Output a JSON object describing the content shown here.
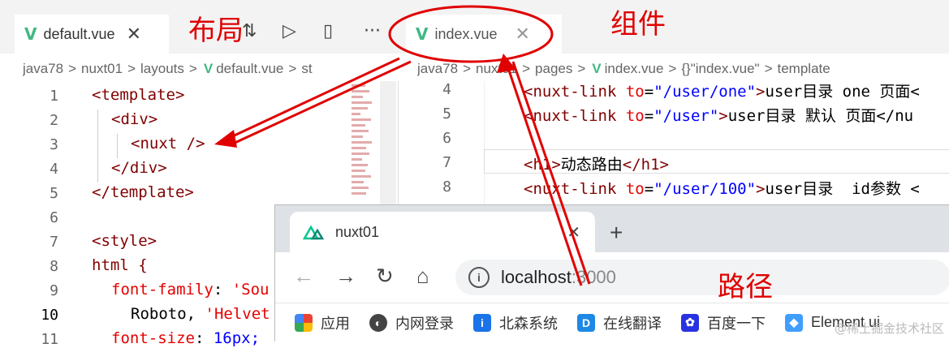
{
  "editor": {
    "tab_left": {
      "name": "default.vue",
      "close": "✕"
    },
    "tab_right": {
      "name": "index.vue",
      "close": "✕"
    },
    "toolbar_icons": [
      "compare-icon",
      "run-icon",
      "split-icon",
      "more-icon"
    ],
    "breadcrumb_left": [
      "java78",
      "nuxt01",
      "layouts",
      "default.vue",
      "st"
    ],
    "breadcrumb_right": [
      "java78",
      "nuxt01",
      "pages",
      "index.vue",
      "{}\"index.vue\"",
      "template"
    ],
    "left_lines": [
      {
        "n": "1",
        "parts": [
          [
            "tag",
            "<template>"
          ]
        ],
        "indent": 0
      },
      {
        "n": "2",
        "parts": [
          [
            "tag",
            "<div>"
          ]
        ],
        "indent": 1
      },
      {
        "n": "3",
        "parts": [
          [
            "tag",
            "<nuxt />"
          ]
        ],
        "indent": 2
      },
      {
        "n": "4",
        "parts": [
          [
            "tag",
            "</div>"
          ]
        ],
        "indent": 1
      },
      {
        "n": "5",
        "parts": [
          [
            "tag",
            "</template>"
          ]
        ],
        "indent": 0
      },
      {
        "n": "6",
        "parts": [],
        "indent": 0
      },
      {
        "n": "7",
        "parts": [
          [
            "tag",
            "<style>"
          ]
        ],
        "indent": 0
      },
      {
        "n": "8",
        "parts": [
          [
            "sel",
            "html {"
          ]
        ],
        "indent": 0
      },
      {
        "n": "9",
        "parts": [
          [
            "prop",
            "font-family"
          ],
          [
            "txt",
            ": "
          ],
          [
            "attr",
            "'Sou"
          ]
        ],
        "indent": 1
      },
      {
        "n": "10",
        "parts": [
          [
            "txt",
            "Roboto, "
          ],
          [
            "attr",
            "'Helvet"
          ]
        ],
        "indent": 2
      },
      {
        "n": "11",
        "parts": [
          [
            "prop",
            "font-size"
          ],
          [
            "txt",
            ": "
          ],
          [
            "str",
            "16px;"
          ]
        ],
        "indent": 1
      }
    ],
    "right_lines": [
      {
        "n": "4",
        "parts": [
          [
            "tag",
            "<nuxt-link "
          ],
          [
            "attr",
            "to"
          ],
          [
            "txt",
            "="
          ],
          [
            "str",
            "\"/user/one\""
          ],
          [
            "tag",
            ">"
          ],
          [
            "txt",
            "user目录 one 页面<"
          ]
        ]
      },
      {
        "n": "5",
        "parts": [
          [
            "tag",
            "<nuxt-link "
          ],
          [
            "attr",
            "to"
          ],
          [
            "txt",
            "="
          ],
          [
            "str",
            "\"/user\""
          ],
          [
            "tag",
            ">"
          ],
          [
            "txt",
            "user目录 默认 页面</nu"
          ]
        ]
      },
      {
        "n": "6",
        "parts": []
      },
      {
        "n": "7",
        "parts": [
          [
            "tag",
            "<h1>"
          ],
          [
            "txt",
            "动态路由"
          ],
          [
            "tag",
            "</h1>"
          ]
        ]
      },
      {
        "n": "8",
        "parts": [
          [
            "tag",
            "<nuxt-link "
          ],
          [
            "attr",
            "to"
          ],
          [
            "txt",
            "="
          ],
          [
            "str",
            "\"/user/100\""
          ],
          [
            "tag",
            ">"
          ],
          [
            "txt",
            "user目录  id参数 <"
          ]
        ]
      }
    ]
  },
  "browser": {
    "tab_title": "nuxt01",
    "tab_close": "✕",
    "new_tab": "+",
    "address_host": "localhost",
    "address_port": ":3000",
    "bookmarks": [
      {
        "label": "应用",
        "color": "#4285f4",
        "icon": "apps-icon"
      },
      {
        "label": "内网登录",
        "color": "#444444",
        "icon": "globe-icon"
      },
      {
        "label": "北森系统",
        "color": "#1a73e8",
        "icon": "info-icon"
      },
      {
        "label": "在线翻译",
        "color": "#1e88e5",
        "icon": "d-icon"
      },
      {
        "label": "百度一下",
        "color": "#2932e1",
        "icon": "paw-icon"
      },
      {
        "label": "Element ui",
        "color": "#409eff",
        "icon": "element-icon"
      }
    ]
  },
  "annotations": {
    "layout": "布局",
    "component": "组件",
    "path": "路径",
    "watermark": "@稀土掘金技术社区"
  }
}
